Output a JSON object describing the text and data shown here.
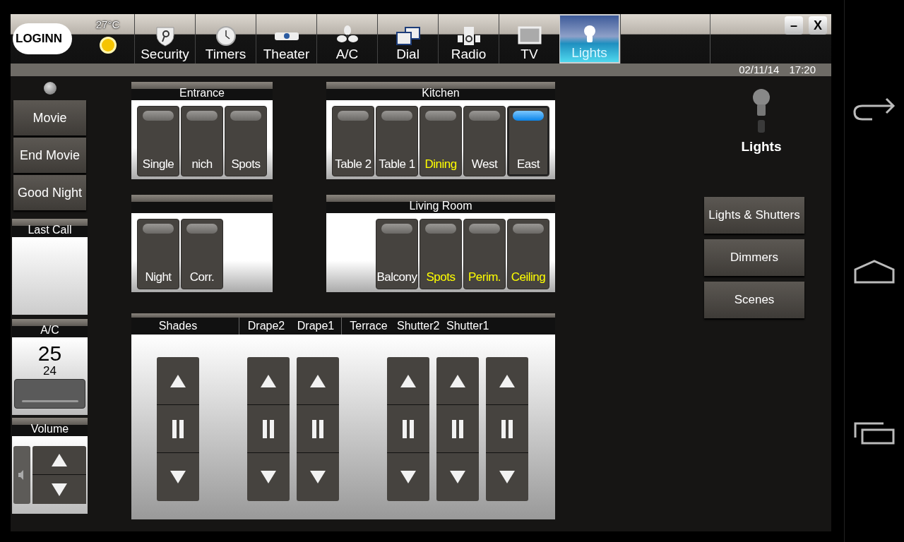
{
  "topbar": {
    "logo": "LOGINN",
    "temperature": "27°C",
    "tabs": [
      {
        "label": "Security",
        "selected": false
      },
      {
        "label": "Timers",
        "selected": false
      },
      {
        "label": "Theater",
        "selected": false
      },
      {
        "label": "A/C",
        "selected": false
      },
      {
        "label": "Dial",
        "selected": false
      },
      {
        "label": "Radio",
        "selected": false
      },
      {
        "label": "TV",
        "selected": false
      },
      {
        "label": "Lights",
        "selected": true
      }
    ],
    "minimize": "–",
    "close": "X",
    "date": "02/11/14",
    "time": "17:20"
  },
  "scenes": [
    "Movie",
    "End Movie",
    "Good Night"
  ],
  "last_call": {
    "title": "Last Call"
  },
  "ac": {
    "title": "A/C",
    "current": "25",
    "setpoint": "24"
  },
  "volume": {
    "title": "Volume"
  },
  "rooms": [
    {
      "title": "Entrance",
      "switches": [
        {
          "label": "Single",
          "on": false,
          "lit": false
        },
        {
          "label": "nich",
          "on": false,
          "lit": false
        },
        {
          "label": "Spots",
          "on": false,
          "lit": false
        }
      ]
    },
    {
      "title": "Kitchen",
      "switches": [
        {
          "label": "Table 2",
          "on": false,
          "lit": false
        },
        {
          "label": "Table 1",
          "on": false,
          "lit": false
        },
        {
          "label": "Dining",
          "on": false,
          "lit": true
        },
        {
          "label": "West",
          "on": false,
          "lit": false
        },
        {
          "label": "East",
          "on": true,
          "lit": false
        }
      ]
    },
    {
      "switches": [
        {
          "label": "Night",
          "on": false,
          "lit": false
        },
        {
          "label": "Corr.",
          "on": false,
          "lit": false
        }
      ]
    },
    {
      "title": "Living Room",
      "switches": [
        {
          "label": "Balcony",
          "on": false,
          "lit": false
        },
        {
          "label": "Spots",
          "on": false,
          "lit": true
        },
        {
          "label": "Perim.",
          "on": false,
          "lit": true
        },
        {
          "label": "Ceiling",
          "on": false,
          "lit": true
        }
      ]
    }
  ],
  "shades": {
    "groups": [
      [
        "Shades"
      ],
      [
        "Drape2",
        "Drape1"
      ],
      [
        "Terrace",
        "Shutter2",
        "Shutter1"
      ]
    ]
  },
  "side": {
    "title": "Lights",
    "buttons": [
      "Lights & Shutters",
      "Dimmers",
      "Scenes"
    ]
  }
}
